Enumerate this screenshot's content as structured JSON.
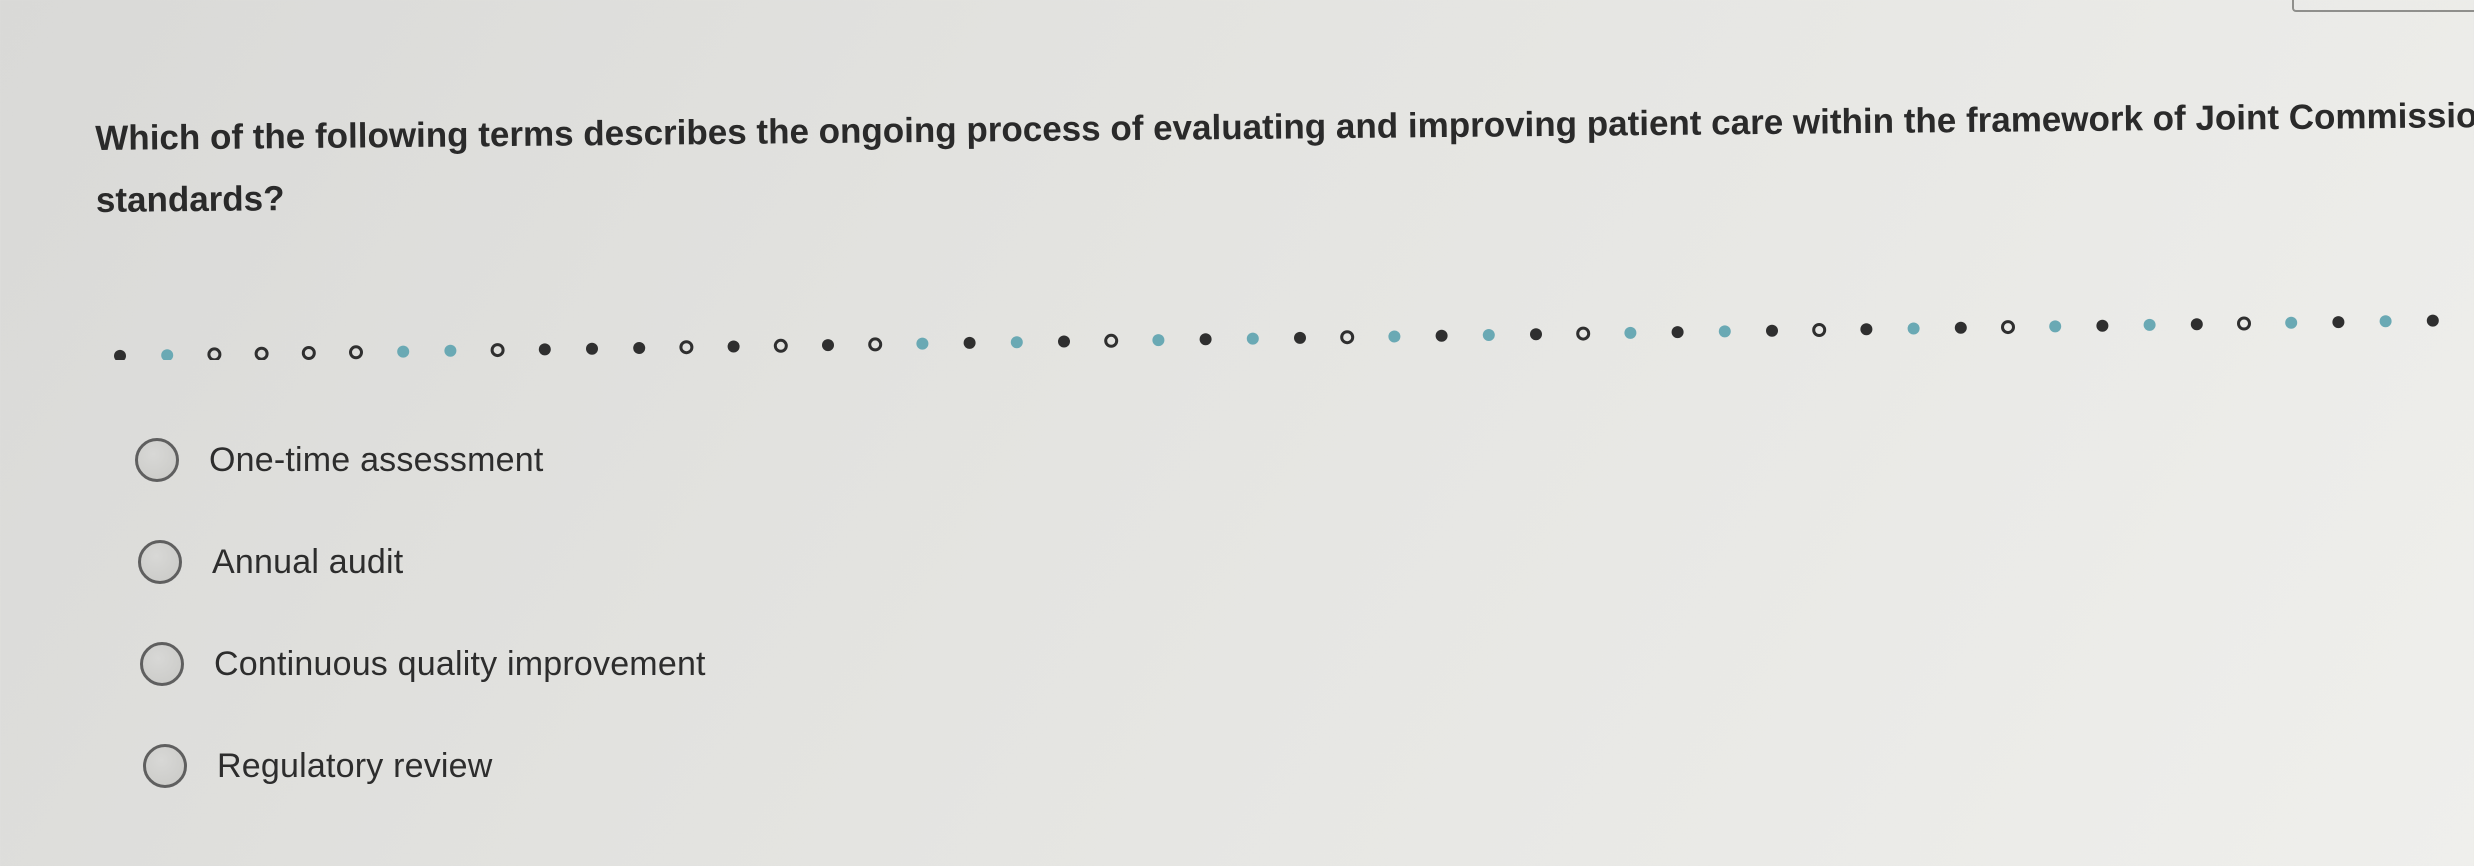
{
  "question": {
    "text": "Which of the following terms describes the ongoing process of evaluating and improving patient care within the framework of Joint Commission standards?"
  },
  "options": [
    {
      "label": "One-time assessment"
    },
    {
      "label": "Annual audit"
    },
    {
      "label": "Continuous quality improvement"
    },
    {
      "label": "Regulatory review"
    }
  ],
  "colors": {
    "dot_dark": "#2f2f2f",
    "dot_teal": "#6aa9b4",
    "radio_border": "#5f5f5f",
    "text": "#2b2b2b"
  }
}
